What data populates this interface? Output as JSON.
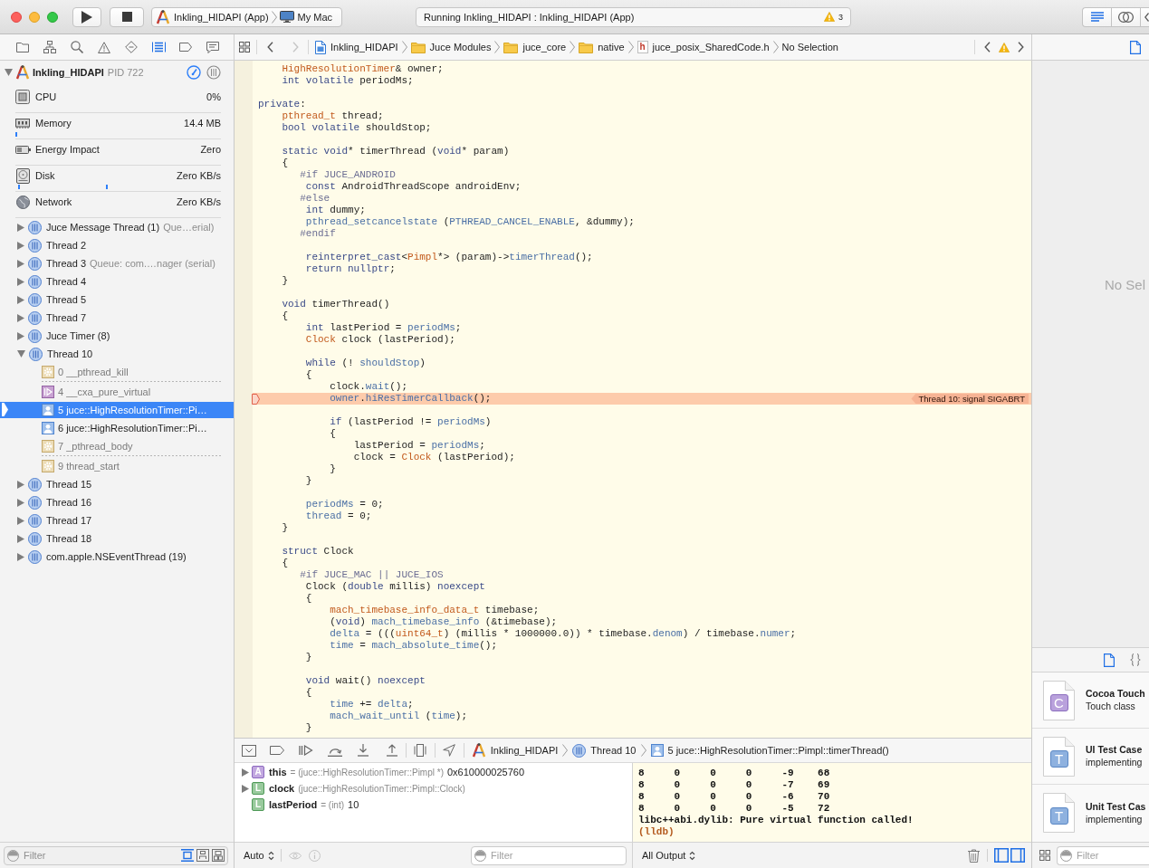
{
  "toolbar": {
    "scheme": "Inkling_HIDAPI (App)",
    "destination": "My Mac",
    "activity": "Running Inkling_HIDAPI : Inkling_HIDAPI (App)",
    "warning_count": "3",
    "editor_modes": [
      {
        "selected": true
      },
      {
        "selected": false
      },
      {
        "selected": false
      }
    ]
  },
  "navigator_tabs": [
    {
      "selected": false
    },
    {
      "selected": false
    },
    {
      "selected": false
    },
    {
      "selected": false
    },
    {
      "selected": false
    },
    {
      "selected": true
    },
    {
      "selected": false
    },
    {
      "selected": false
    }
  ],
  "jump_bar": {
    "history": [
      {
        "kind": "back",
        "disabled": false
      },
      {
        "kind": "forward",
        "disabled": true
      }
    ],
    "path": [
      {
        "kind": "project",
        "label": "Inkling_HIDAPI"
      },
      {
        "kind": "folder",
        "label": "Juce Modules"
      },
      {
        "kind": "folder",
        "label": "juce_core"
      },
      {
        "kind": "folder",
        "label": "native"
      },
      {
        "kind": "header",
        "symbol": "h",
        "label": "juce_posix_SharedCode.h"
      },
      {
        "kind": "symbol",
        "label": "No Selection"
      }
    ]
  },
  "debug_navigator": {
    "process": {
      "name": "Inkling_HIDAPI",
      "pid": "PID 722",
      "expanded": true
    },
    "view_modes": [
      {
        "selected": true
      },
      {
        "selected": false
      }
    ],
    "gauges": [
      {
        "kind": "cpu",
        "label": "CPU",
        "value": "0%",
        "graph": false
      },
      {
        "kind": "memory",
        "label": "Memory",
        "value": "14.4 MB",
        "graph": true
      },
      {
        "kind": "energy",
        "label": "Energy Impact",
        "value": "Zero",
        "graph": false
      },
      {
        "kind": "disk",
        "label": "Disk",
        "value": "Zero KB/s",
        "graph": true
      },
      {
        "kind": "network",
        "label": "Network",
        "value": "Zero KB/s",
        "graph": false
      }
    ],
    "threads": [
      {
        "label": "Juce Message Thread (1)",
        "queue": "Que…erial)",
        "expanded": false
      },
      {
        "label": "Thread 2",
        "expanded": false
      },
      {
        "label": "Thread 3",
        "queue": "Queue: com.…nager (serial)",
        "expanded": false
      },
      {
        "label": "Thread 4",
        "expanded": false
      },
      {
        "label": "Thread 5",
        "expanded": false
      },
      {
        "label": "Thread 7",
        "expanded": false
      },
      {
        "label": "Juce Timer (8)",
        "expanded": false
      },
      {
        "label": "Thread 10",
        "expanded": true,
        "frames": [
          {
            "kind": "system",
            "label": "0 __pthread_kill",
            "selected": false,
            "gap_after": true
          },
          {
            "kind": "runtime",
            "label": "4 __cxa_pure_virtual",
            "selected": false,
            "gap_after": false
          },
          {
            "kind": "user",
            "label": "5 juce::HighResolutionTimer::Pi…",
            "selected": true,
            "gap_after": false
          },
          {
            "kind": "user",
            "label": "6 juce::HighResolutionTimer::Pi…",
            "selected": false,
            "gap_after": false
          },
          {
            "kind": "system",
            "label": "7 _pthread_body",
            "selected": false,
            "gap_after": true
          },
          {
            "kind": "system",
            "label": "9 thread_start",
            "selected": false,
            "gap_after": false
          }
        ]
      },
      {
        "label": "Thread 15",
        "expanded": false
      },
      {
        "label": "Thread 16",
        "expanded": false
      },
      {
        "label": "Thread 17",
        "expanded": false
      },
      {
        "label": "Thread 18",
        "expanded": false
      },
      {
        "label": "com.apple.NSEventThread (19)",
        "expanded": false
      }
    ],
    "filter": {
      "placeholder": "Filter",
      "options": [
        {
          "selected": true
        },
        {
          "selected": false
        },
        {
          "selected": false
        }
      ]
    }
  },
  "editor": {
    "blocks": [
      {
        "lines": [
          {
            "tokens": [
              {
                "kind": "type",
                "text": "    HighResolutionTimer"
              },
              {
                "kind": "plain",
                "text": "& owner;"
              }
            ]
          },
          {
            "tokens": [
              {
                "kind": "keyword",
                "text": "    int volatile"
              },
              {
                "kind": "plain",
                "text": " periodMs;"
              }
            ]
          }
        ]
      },
      {
        "lines": [
          {
            "tokens": [
              {
                "kind": "keyword",
                "text": "private"
              },
              {
                "kind": "plain",
                "text": ":"
              }
            ]
          },
          {
            "tokens": [
              {
                "kind": "type",
                "text": "    pthread_t"
              },
              {
                "kind": "plain",
                "text": " thread;"
              }
            ]
          },
          {
            "tokens": [
              {
                "kind": "keyword",
                "text": "    bool volatile"
              },
              {
                "kind": "plain",
                "text": " shouldStop;"
              }
            ]
          }
        ]
      },
      {
        "lines": [
          {
            "tokens": [
              {
                "kind": "keyword",
                "text": "    static void"
              },
              {
                "kind": "plain",
                "text": "* timerThread ("
              },
              {
                "kind": "keyword",
                "text": "void"
              },
              {
                "kind": "plain",
                "text": "* param)"
              }
            ]
          },
          {
            "tokens": [
              {
                "kind": "plain",
                "text": "    {"
              }
            ]
          },
          {
            "tokens": [
              {
                "kind": "macro",
                "text": "       #if JUCE_ANDROID"
              }
            ]
          },
          {
            "tokens": [
              {
                "kind": "keyword",
                "text": "        const"
              },
              {
                "kind": "plain",
                "text": " AndroidThreadScope androidEnv;"
              }
            ]
          },
          {
            "tokens": [
              {
                "kind": "macro",
                "text": "       #else"
              }
            ]
          },
          {
            "tokens": [
              {
                "kind": "keyword",
                "text": "        int"
              },
              {
                "kind": "plain",
                "text": " dummy;"
              }
            ]
          },
          {
            "tokens": [
              {
                "kind": "member",
                "text": "        pthread_setcancelstate"
              },
              {
                "kind": "plain",
                "text": " ("
              },
              {
                "kind": "member",
                "text": "PTHREAD_CANCEL_ENABLE"
              },
              {
                "kind": "plain",
                "text": ", &dummy);"
              }
            ]
          },
          {
            "tokens": [
              {
                "kind": "macro",
                "text": "       #endif"
              }
            ]
          }
        ]
      },
      {
        "lines": [
          {
            "tokens": [
              {
                "kind": "keyword",
                "text": "        reinterpret_cast"
              },
              {
                "kind": "plain",
                "text": "<"
              },
              {
                "kind": "type",
                "text": "Pimpl"
              },
              {
                "kind": "plain",
                "text": "*> (param)->"
              },
              {
                "kind": "member",
                "text": "timerThread"
              },
              {
                "kind": "plain",
                "text": "();"
              }
            ]
          },
          {
            "tokens": [
              {
                "kind": "keyword",
                "text": "        return nullptr"
              },
              {
                "kind": "plain",
                "text": ";"
              }
            ]
          },
          {
            "tokens": [
              {
                "kind": "plain",
                "text": "    }"
              }
            ]
          }
        ]
      },
      {
        "lines": [
          {
            "tokens": [
              {
                "kind": "keyword",
                "text": "    void"
              },
              {
                "kind": "plain",
                "text": " timerThread()"
              }
            ]
          },
          {
            "tokens": [
              {
                "kind": "plain",
                "text": "    {"
              }
            ]
          },
          {
            "tokens": [
              {
                "kind": "keyword",
                "text": "        int"
              },
              {
                "kind": "plain",
                "text": " lastPeriod = "
              },
              {
                "kind": "member",
                "text": "periodMs"
              },
              {
                "kind": "plain",
                "text": ";"
              }
            ]
          },
          {
            "tokens": [
              {
                "kind": "type",
                "text": "        Clock"
              },
              {
                "kind": "plain",
                "text": " clock (lastPeriod);"
              }
            ]
          }
        ]
      },
      {
        "lines": [
          {
            "tokens": [
              {
                "kind": "keyword",
                "text": "        while"
              },
              {
                "kind": "plain",
                "text": " (! "
              },
              {
                "kind": "member",
                "text": "shouldStop"
              },
              {
                "kind": "plain",
                "text": ")"
              }
            ]
          },
          {
            "tokens": [
              {
                "kind": "plain",
                "text": "        {"
              }
            ]
          },
          {
            "tokens": [
              {
                "kind": "plain",
                "text": "            clock."
              },
              {
                "kind": "member",
                "text": "wait"
              },
              {
                "kind": "plain",
                "text": "();"
              }
            ]
          },
          {
            "tokens": [
              {
                "kind": "member",
                "text": "            owner"
              },
              {
                "kind": "plain",
                "text": "."
              },
              {
                "kind": "member",
                "text": "hiResTimerCallback"
              },
              {
                "kind": "plain",
                "text": "();"
              }
            ],
            "annotation": {
              "kind": "crash",
              "text": "Thread 10: signal SIGABRT"
            }
          }
        ]
      },
      {
        "lines": [
          {
            "tokens": [
              {
                "kind": "keyword",
                "text": "            if"
              },
              {
                "kind": "plain",
                "text": " (lastPeriod != "
              },
              {
                "kind": "member",
                "text": "periodMs"
              },
              {
                "kind": "plain",
                "text": ")"
              }
            ]
          },
          {
            "tokens": [
              {
                "kind": "plain",
                "text": "            {"
              }
            ]
          },
          {
            "tokens": [
              {
                "kind": "plain",
                "text": "                lastPeriod = "
              },
              {
                "kind": "member",
                "text": "periodMs"
              },
              {
                "kind": "plain",
                "text": ";"
              }
            ]
          },
          {
            "tokens": [
              {
                "kind": "plain",
                "text": "                clock = "
              },
              {
                "kind": "type",
                "text": "Clock"
              },
              {
                "kind": "plain",
                "text": " (lastPeriod);"
              }
            ]
          },
          {
            "tokens": [
              {
                "kind": "plain",
                "text": "            }"
              }
            ]
          },
          {
            "tokens": [
              {
                "kind": "plain",
                "text": "        }"
              }
            ]
          }
        ]
      },
      {
        "lines": [
          {
            "tokens": [
              {
                "kind": "member",
                "text": "        periodMs"
              },
              {
                "kind": "plain",
                "text": " = 0;"
              }
            ]
          },
          {
            "tokens": [
              {
                "kind": "member",
                "text": "        thread"
              },
              {
                "kind": "plain",
                "text": " = 0;"
              }
            ]
          },
          {
            "tokens": [
              {
                "kind": "plain",
                "text": "    }"
              }
            ]
          }
        ]
      },
      {
        "lines": [
          {
            "tokens": [
              {
                "kind": "keyword",
                "text": "    struct"
              },
              {
                "kind": "plain",
                "text": " Clock"
              }
            ]
          },
          {
            "tokens": [
              {
                "kind": "plain",
                "text": "    {"
              }
            ]
          },
          {
            "tokens": [
              {
                "kind": "macro",
                "text": "       #if JUCE_MAC || JUCE_IOS"
              }
            ]
          },
          {
            "tokens": [
              {
                "kind": "plain",
                "text": "        Clock ("
              },
              {
                "kind": "keyword",
                "text": "double"
              },
              {
                "kind": "plain",
                "text": " millis) "
              },
              {
                "kind": "keyword",
                "text": "noexcept"
              }
            ]
          },
          {
            "tokens": [
              {
                "kind": "plain",
                "text": "        {"
              }
            ]
          },
          {
            "tokens": [
              {
                "kind": "type",
                "text": "            mach_timebase_info_data_t"
              },
              {
                "kind": "plain",
                "text": " timebase;"
              }
            ]
          },
          {
            "tokens": [
              {
                "kind": "plain",
                "text": "            ("
              },
              {
                "kind": "keyword",
                "text": "void"
              },
              {
                "kind": "plain",
                "text": ") "
              },
              {
                "kind": "member",
                "text": "mach_timebase_info"
              },
              {
                "kind": "plain",
                "text": " (&timebase);"
              }
            ]
          },
          {
            "tokens": [
              {
                "kind": "member",
                "text": "            delta"
              },
              {
                "kind": "plain",
                "text": " = ((("
              },
              {
                "kind": "type",
                "text": "uint64_t"
              },
              {
                "kind": "plain",
                "text": ") (millis * 1000000.0)) * timebase."
              },
              {
                "kind": "member",
                "text": "denom"
              },
              {
                "kind": "plain",
                "text": ") / timebase."
              },
              {
                "kind": "member",
                "text": "numer"
              },
              {
                "kind": "plain",
                "text": ";"
              }
            ]
          },
          {
            "tokens": [
              {
                "kind": "member",
                "text": "            time"
              },
              {
                "kind": "plain",
                "text": " = "
              },
              {
                "kind": "member",
                "text": "mach_absolute_time"
              },
              {
                "kind": "plain",
                "text": "();"
              }
            ]
          },
          {
            "tokens": [
              {
                "kind": "plain",
                "text": "        }"
              }
            ]
          }
        ]
      },
      {
        "lines": [
          {
            "tokens": [
              {
                "kind": "keyword",
                "text": "        void"
              },
              {
                "kind": "plain",
                "text": " wait() "
              },
              {
                "kind": "keyword",
                "text": "noexcept"
              }
            ]
          },
          {
            "tokens": [
              {
                "kind": "plain",
                "text": "        {"
              }
            ]
          },
          {
            "tokens": [
              {
                "kind": "member",
                "text": "            time"
              },
              {
                "kind": "plain",
                "text": " += "
              },
              {
                "kind": "member",
                "text": "delta"
              },
              {
                "kind": "plain",
                "text": ";"
              }
            ]
          },
          {
            "tokens": [
              {
                "kind": "member",
                "text": "            mach_wait_until"
              },
              {
                "kind": "plain",
                "text": " ("
              },
              {
                "kind": "member",
                "text": "time"
              },
              {
                "kind": "plain",
                "text": ");"
              }
            ]
          },
          {
            "tokens": [
              {
                "kind": "plain",
                "text": "        }"
              }
            ]
          }
        ]
      }
    ]
  },
  "debugger": {
    "breakpoints_active": false,
    "path": [
      {
        "kind": "process",
        "label": "Inkling_HIDAPI"
      },
      {
        "kind": "thread",
        "label": "Thread 10"
      },
      {
        "kind": "frame",
        "label": "5 juce::HighResolutionTimer::Pimpl::timerThread()"
      }
    ],
    "variables": [
      {
        "kind": "argument",
        "symbol": "A",
        "name": "this",
        "type": "= (juce::HighResolutionTimer::Pimpl *)",
        "value": "0x610000025760",
        "expandable": true
      },
      {
        "kind": "local",
        "symbol": "L",
        "name": "clock",
        "type": "(juce::HighResolutionTimer::Pimpl::Clock)",
        "expandable": true
      },
      {
        "kind": "local",
        "symbol": "L",
        "name": "lastPeriod",
        "type": "= (int)",
        "value": "10",
        "expandable": false
      }
    ],
    "console": [
      {
        "kind": "output",
        "text": "8     0     0     0     -9    68"
      },
      {
        "kind": "output",
        "text": "8     0     0     0     -7    69"
      },
      {
        "kind": "output",
        "text": "8     0     0     0     -6    70"
      },
      {
        "kind": "output",
        "text": "8     0     0     0     -5    72"
      },
      {
        "kind": "output",
        "text": "libc++abi.dylib: Pure virtual function called!"
      },
      {
        "kind": "prompt",
        "text": "(lldb)"
      }
    ],
    "scope": "Auto",
    "inspect_buttons": [
      {
        "disabled": true
      },
      {
        "disabled": true
      }
    ],
    "filter": {
      "placeholder": "Filter"
    },
    "output": "All Output",
    "panes": [
      {
        "selected": true
      },
      {
        "selected": true
      }
    ]
  },
  "inspector": {
    "tabs": [
      {
        "selected": true
      }
    ],
    "message": "No Sel"
  },
  "library": {
    "tabs": [
      {
        "selected": true
      },
      {
        "selected": false
      }
    ],
    "items": [
      {
        "kind": "class",
        "symbol": "C",
        "title": "Cocoa Touch",
        "subtitle": "Touch class"
      },
      {
        "kind": "test",
        "symbol": "T",
        "title": "UI Test Case",
        "subtitle": "implementing"
      },
      {
        "kind": "test",
        "symbol": "T",
        "title": "Unit Test Cas",
        "subtitle": "implementing"
      }
    ],
    "filter": {
      "placeholder": "Filter"
    }
  }
}
